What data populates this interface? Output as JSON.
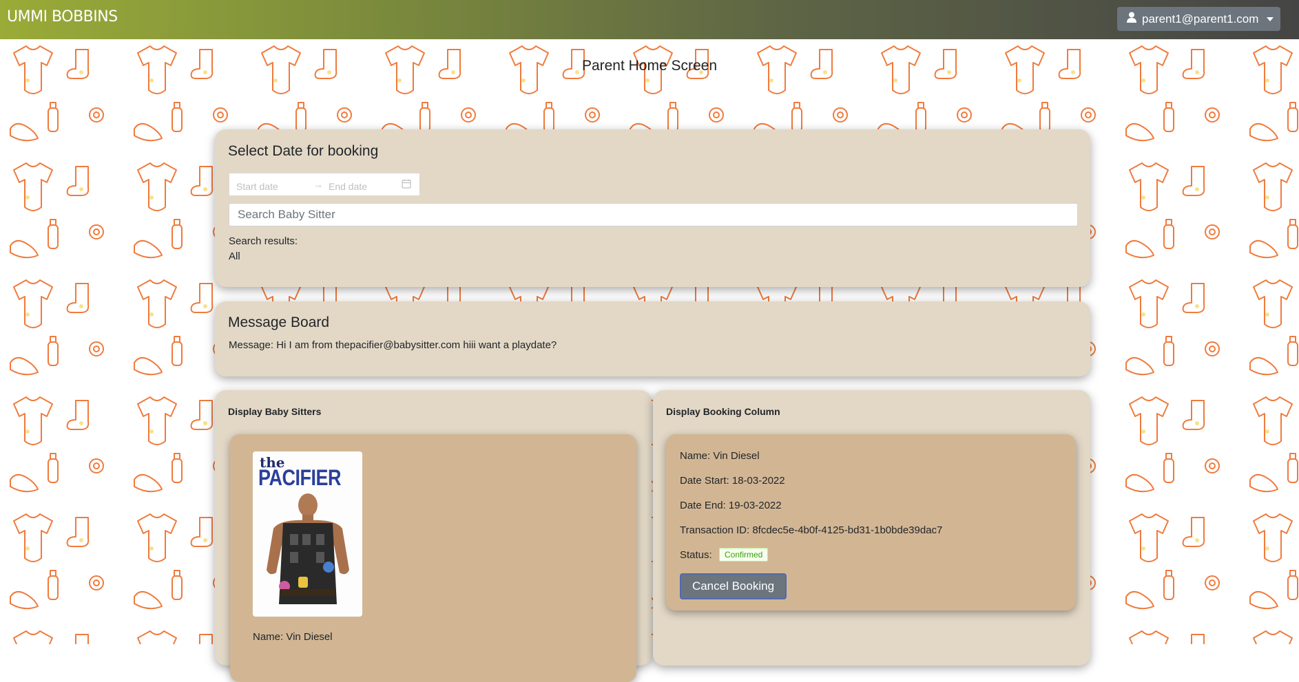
{
  "navbar": {
    "brand": "UMMI BOBBINS",
    "user_email": "parent1@parent1.com",
    "user_icon": "user-icon"
  },
  "page": {
    "title": "Parent Home Screen"
  },
  "booking": {
    "title": "Select Date for booking",
    "start_placeholder": "Start date",
    "end_placeholder": "End date",
    "search_placeholder": "Search Baby Sitter",
    "results_label": "Search results:",
    "results_value": "All"
  },
  "message_board": {
    "title": "Message Board",
    "message": "Message: Hi I am from thepacifier@babysitter.com hiii want a playdate?"
  },
  "sitters": {
    "title": "Display Baby Sitters",
    "poster_line1": "the",
    "poster_line2": "PACIFIER",
    "name": "Name: Vin Diesel"
  },
  "bookings": {
    "title": "Display Booking Column",
    "name": "Name: Vin Diesel",
    "date_start": "Date Start: 18-03-2022",
    "date_end": "Date End: 19-03-2022",
    "transaction": "Transaction ID: 8fcdec5e-4b0f-4125-bd31-1b0bde39dac7",
    "status_label": "Status:",
    "status_value": "Confirmed",
    "cancel_label": "Cancel Booking"
  },
  "colors": {
    "accent_start": "#9aab38",
    "navbar_end": "#454545",
    "card_bg": "#e3d8c6",
    "inner_bg": "#d2b694",
    "pattern": "#f07a3c"
  }
}
